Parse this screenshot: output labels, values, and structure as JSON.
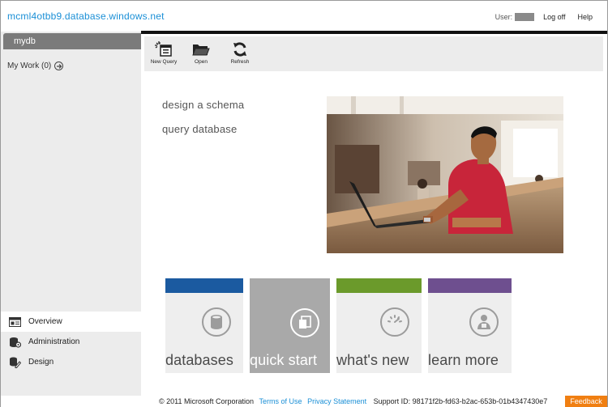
{
  "header": {
    "server_name": "mcml4otbb9.database.windows.net",
    "user_label": "User:",
    "logoff_label": "Log off",
    "help_label": "Help"
  },
  "sidebar": {
    "database_tab": "mydb",
    "my_work": "My Work (0)",
    "nav_items": [
      {
        "label": "Overview",
        "icon": "overview-icon",
        "active": true
      },
      {
        "label": "Administration",
        "icon": "administration-icon",
        "active": false
      },
      {
        "label": "Design",
        "icon": "design-icon",
        "active": false
      }
    ]
  },
  "toolbar": {
    "new_query_label": "New Query",
    "open_label": "Open",
    "refresh_label": "Refresh"
  },
  "main": {
    "links": [
      "design a schema",
      "query database"
    ]
  },
  "tiles": [
    {
      "label": "databases",
      "icon": "database-icon",
      "color": "#1b5aa0",
      "active": false
    },
    {
      "label": "quick start",
      "icon": "quick-start-icon",
      "color": "#a9a9a9",
      "active": true
    },
    {
      "label": "what's new",
      "icon": "whats-new-icon",
      "color": "#6b9a2b",
      "active": false
    },
    {
      "label": "learn more",
      "icon": "learn-more-icon",
      "color": "#6e4f8f",
      "active": false
    }
  ],
  "footer": {
    "copyright": "© 2011 Microsoft Corporation",
    "terms_label": "Terms of Use",
    "privacy_label": "Privacy Statement",
    "support_id": "Support ID:  98171f2b-fd63-b2ac-653b-01b4347430e7",
    "feedback_label": "Feedback"
  },
  "colors": {
    "accent_link": "#1a8fd6",
    "feedback": "#f07f12"
  }
}
